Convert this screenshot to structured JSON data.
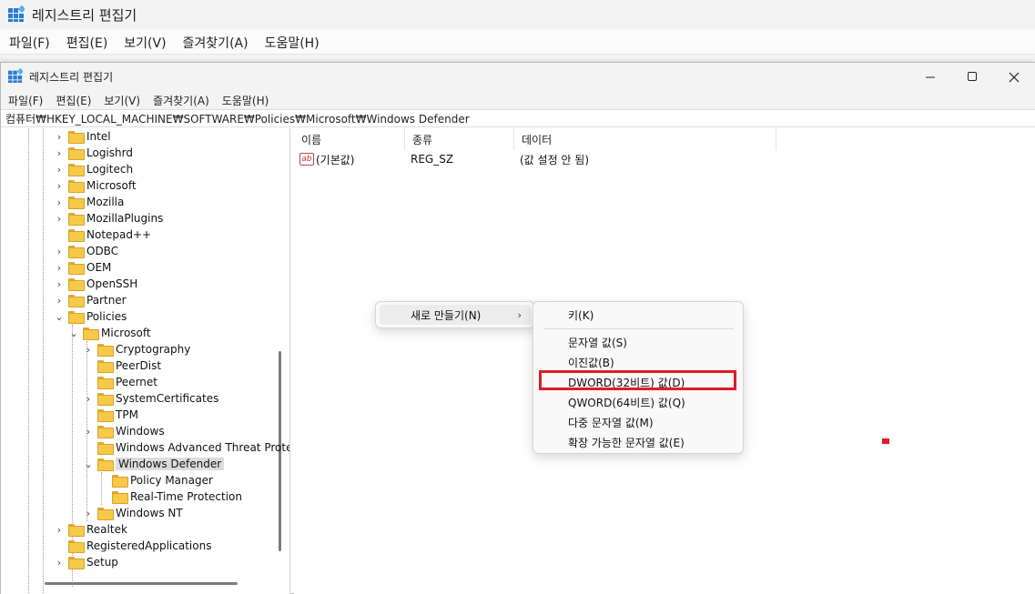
{
  "background_window": {
    "title": "레지스트리 편집기",
    "menu": [
      "파일(F)",
      "편집(E)",
      "보기(V)",
      "즐겨찾기(A)",
      "도움말(H)"
    ]
  },
  "window": {
    "title": "레지스트리 편집기",
    "controls": {
      "minimize": "—",
      "maximize": "☐",
      "close": "✕"
    },
    "menu": [
      "파일(F)",
      "편집(E)",
      "보기(V)",
      "즐겨찾기(A)",
      "도움말(H)"
    ],
    "address": "컴퓨터₩HKEY_LOCAL_MACHINE₩SOFTWARE₩Policies₩Microsoft₩Windows Defender"
  },
  "tree": {
    "items": [
      {
        "label": "Intel",
        "expander": "›"
      },
      {
        "label": "Logishrd",
        "expander": "›"
      },
      {
        "label": "Logitech",
        "expander": "›"
      },
      {
        "label": "Microsoft",
        "expander": "›"
      },
      {
        "label": "Mozilla",
        "expander": "›"
      },
      {
        "label": "MozillaPlugins",
        "expander": "›"
      },
      {
        "label": "Notepad++",
        "expander": ""
      },
      {
        "label": "ODBC",
        "expander": "›"
      },
      {
        "label": "OEM",
        "expander": "›"
      },
      {
        "label": "OpenSSH",
        "expander": "›"
      },
      {
        "label": "Partner",
        "expander": "›"
      },
      {
        "label": "Policies",
        "expander": "⌄"
      },
      {
        "label": "Microsoft",
        "expander": "⌄"
      },
      {
        "label": "Cryptography",
        "expander": "›"
      },
      {
        "label": "PeerDist",
        "expander": ""
      },
      {
        "label": "Peernet",
        "expander": ""
      },
      {
        "label": "SystemCertificates",
        "expander": "›"
      },
      {
        "label": "TPM",
        "expander": ""
      },
      {
        "label": "Windows",
        "expander": "›"
      },
      {
        "label": "Windows Advanced Threat Prote",
        "expander": ""
      },
      {
        "label": "Windows Defender",
        "expander": "⌄",
        "selected": true
      },
      {
        "label": "Policy Manager",
        "expander": ""
      },
      {
        "label": "Real-Time Protection",
        "expander": ""
      },
      {
        "label": "Windows NT",
        "expander": "›"
      },
      {
        "label": "Realtek",
        "expander": "›"
      },
      {
        "label": "RegisteredApplications",
        "expander": ""
      },
      {
        "label": "Setup",
        "expander": "›"
      }
    ]
  },
  "list": {
    "columns": [
      "이름",
      "종류",
      "데이터"
    ],
    "rows": [
      {
        "icon": "ab",
        "name": "(기본값)",
        "type": "REG_SZ",
        "data": "(값 설정 안 됨)"
      }
    ]
  },
  "context_menu": {
    "new_label": "새로 만들기(N)",
    "arrow": "›",
    "submenu": [
      "키(K)",
      "문자열 값(S)",
      "이진값(B)",
      "DWORD(32비트) 값(D)",
      "QWORD(64비트) 값(Q)",
      "다중 문자열 값(M)",
      "확장 가능한 문자열 값(E)"
    ],
    "highlighted": "DWORD(32비트) 값(D)",
    "highlight_color": "#e01b24"
  },
  "colors": {
    "folder": "#f7c948",
    "selection": "#dcdcdc",
    "accent_red": "#e01b24"
  }
}
